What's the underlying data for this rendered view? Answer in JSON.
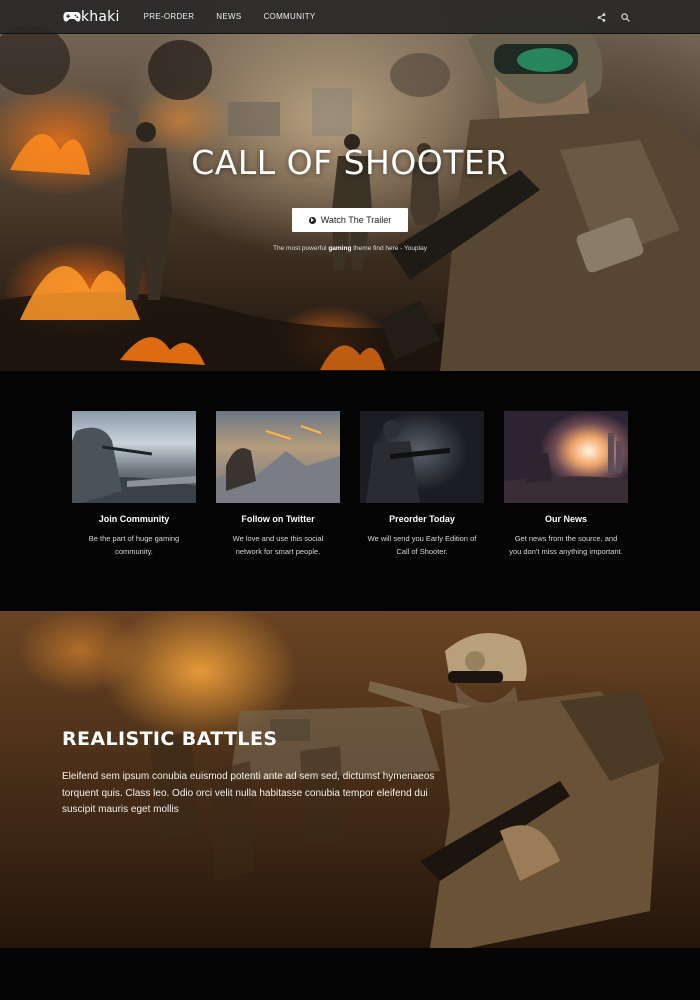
{
  "nav": {
    "logo_text": "khaki",
    "items": [
      {
        "label": "PRE-ORDER"
      },
      {
        "label": "NEWS"
      },
      {
        "label": "COMMUNITY"
      }
    ],
    "icons": [
      "gamepad-icon",
      "share-icon",
      "search-icon"
    ]
  },
  "hero": {
    "title": "CALL OF SHOOTER",
    "button_label": "Watch The Trailer",
    "tagline_pre": "The most powerful ",
    "tagline_bold": "gaming",
    "tagline_post": " theme find here - Youplay"
  },
  "features": [
    {
      "title": "Join Community",
      "text": "Be the part of huge gaming community."
    },
    {
      "title": "Follow on Twitter",
      "text": "We love and use this social network for smart people."
    },
    {
      "title": "Preorder Today",
      "text": "We will send you Early Edition of Call of Shooter."
    },
    {
      "title": "Our News",
      "text": "Get news from the source, and you don't miss anything important."
    }
  ],
  "battle": {
    "title": "REALISTIC BATTLES",
    "text": "Eleifend sem ipsum conubia euismod potenti ante ad sem sed, dictumst hymenaeos torquent quis. Class leo. Odio orci velit nulla habitasse conubia tempor eleifend dui suscipit mauris eget mollis"
  },
  "colors": {
    "nav_bg": "#282828",
    "features_bg": "#040404",
    "button_bg": "#ffffff",
    "accent_fire": "#ff7a14"
  }
}
